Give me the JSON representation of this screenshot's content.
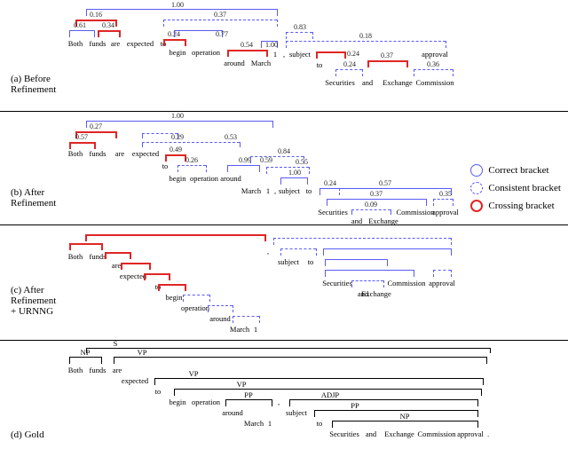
{
  "chart_data": {
    "type": "table",
    "sentence": [
      "Both",
      "funds",
      "are",
      "expected",
      "to",
      "begin",
      "operation",
      "around",
      "March",
      "1",
      ",",
      "subject",
      "to",
      "Securities",
      "and",
      "Exchange",
      "Commission",
      "approval",
      "."
    ],
    "legend": [
      "Correct bracket",
      "Consistent bracket",
      "Crossing bracket"
    ],
    "panels": {
      "before_refinement": {
        "label": "(a) Before Refinement",
        "brackets": [
          {
            "span": [
              1,
              2
            ],
            "type": "correct",
            "score": 0.61
          },
          {
            "span": [
              2,
              3
            ],
            "type": "crossing",
            "score": 0.34
          },
          {
            "span": [
              1,
              3
            ],
            "type": "crossing",
            "score": 0.16
          },
          {
            "span": [
              1,
              4
            ],
            "type": "correct",
            "score": 1.0
          },
          {
            "span": [
              5,
              6
            ],
            "type": "crossing",
            "score": 0.24
          },
          {
            "span": [
              5,
              7
            ],
            "type": "correct",
            "score": 0.77
          },
          {
            "span": [
              8,
              9
            ],
            "type": "crossing",
            "score": 0.54
          },
          {
            "span": [
              5,
              9
            ],
            "type": "consistent",
            "score": 0.37
          },
          {
            "span": [
              9,
              10
            ],
            "type": "correct",
            "score": 1.0
          },
          {
            "span": [
              11,
              12
            ],
            "type": "consistent",
            "score": 0.83
          },
          {
            "span": [
              11,
              13
            ],
            "type": "consistent",
            "score": 0.18
          },
          {
            "span": [
              13,
              14
            ],
            "type": "crossing",
            "score": 0.24
          },
          {
            "span": [
              14,
              15
            ],
            "type": "consistent",
            "score": 0.24
          },
          {
            "span": [
              15,
              16
            ],
            "type": "crossing",
            "score": 0.37
          },
          {
            "span": [
              16,
              17
            ],
            "type": "consistent",
            "score": 0.36
          },
          {
            "span": [
              14,
              17
            ],
            "type": "consistent",
            "score": 0.24
          }
        ]
      },
      "after_refinement": {
        "label": "(b) After Refinement",
        "brackets": [
          {
            "span": [
              1,
              2
            ],
            "type": "crossing",
            "score": 0.57
          },
          {
            "span": [
              1,
              3
            ],
            "type": "crossing",
            "score": 0.27
          },
          {
            "span": [
              1,
              4
            ],
            "type": "correct",
            "score": 1.0
          },
          {
            "span": [
              4,
              5
            ],
            "type": "consistent",
            "score": 0.29
          },
          {
            "span": [
              5,
              6
            ],
            "type": "crossing",
            "score": 0.49
          },
          {
            "span": [
              6,
              7
            ],
            "type": "consistent",
            "score": 0.26
          },
          {
            "span": [
              4,
              7
            ],
            "type": "consistent",
            "score": 0.53
          },
          {
            "span": [
              7,
              8
            ],
            "type": "consistent",
            "score": 0.59
          },
          {
            "span": [
              4,
              9
            ],
            "type": "correct",
            "score": 0.99
          },
          {
            "span": [
              9,
              10
            ],
            "type": "consistent",
            "score": 0.84
          },
          {
            "span": [
              10,
              11
            ],
            "type": "consistent",
            "score": 0.55
          },
          {
            "span": [
              11,
              12
            ],
            "type": "correct",
            "score": 1.0
          },
          {
            "span": [
              12,
              13
            ],
            "type": "consistent",
            "score": 0.24
          },
          {
            "span": [
              13,
              14
            ],
            "type": "correct",
            "score": 0.57
          },
          {
            "span": [
              14,
              15
            ],
            "type": "consistent",
            "score": 0.09
          },
          {
            "span": [
              13,
              16
            ],
            "type": "correct",
            "score": 0.37
          },
          {
            "span": [
              16,
              17
            ],
            "type": "consistent",
            "score": 0.35
          }
        ]
      },
      "after_refinement_urnng": {
        "label": "(c) After Refinement + URNNG",
        "brackets": [
          {
            "span": [
              1,
              2
            ],
            "type": "crossing"
          },
          {
            "span": [
              1,
              3
            ],
            "type": "crossing"
          },
          {
            "span": [
              1,
              4
            ],
            "type": "crossing"
          },
          {
            "span": [
              1,
              5
            ],
            "type": "crossing"
          },
          {
            "span": [
              1,
              6
            ],
            "type": "crossing"
          },
          {
            "span": [
              6,
              7
            ],
            "type": "consistent"
          },
          {
            "span": [
              7,
              8
            ],
            "type": "consistent"
          },
          {
            "span": [
              8,
              9
            ],
            "type": "consistent"
          },
          {
            "span": [
              9,
              10
            ],
            "type": "consistent"
          },
          {
            "span": [
              11,
              12
            ],
            "type": "consistent"
          },
          {
            "span": [
              11,
              13
            ],
            "type": "consistent"
          },
          {
            "span": [
              14,
              15
            ],
            "type": "consistent"
          },
          {
            "span": [
              13,
              15
            ],
            "type": "correct"
          },
          {
            "span": [
              13,
              16
            ],
            "type": "correct"
          },
          {
            "span": [
              16,
              17
            ],
            "type": "consistent"
          },
          {
            "span": [
              13,
              18
            ],
            "type": "correct"
          }
        ]
      },
      "gold": {
        "label": "(d) Gold",
        "nodes": [
          "S",
          "NP",
          "VP",
          "VP",
          "VP",
          "PP",
          "ADJP",
          "PP",
          "NP"
        ],
        "brackets": [
          {
            "span": [
              1,
              2
            ],
            "tag": "NP"
          },
          {
            "span": [
              1,
              19
            ],
            "tag": "S"
          },
          {
            "span": [
              3,
              18
            ],
            "tag": "VP"
          },
          {
            "span": [
              5,
              18
            ],
            "tag": "VP"
          },
          {
            "span": [
              8,
              10
            ],
            "tag": "PP"
          },
          {
            "span": [
              6,
              18
            ],
            "tag": "VP"
          },
          {
            "span": [
              12,
              18
            ],
            "tag": "ADJP"
          },
          {
            "span": [
              13,
              18
            ],
            "tag": "PP"
          },
          {
            "span": [
              14,
              18
            ],
            "tag": "NP"
          }
        ]
      }
    }
  },
  "labels": {
    "panel_a": "(a) Before",
    "panel_a2": "Refinement",
    "panel_b": "(b) After",
    "panel_b2": "Refinement",
    "panel_c": "(c) After",
    "panel_c2": "Refinement",
    "panel_c3": "+ URNNG",
    "panel_d": "(d) Gold"
  },
  "legend": {
    "correct": "Correct bracket",
    "consistent": "Consistent bracket",
    "crossing": "Crossing bracket"
  },
  "sentence": {
    "w1": "Both",
    "w2": "funds",
    "w3": "are",
    "w4": "expected",
    "w5": "to",
    "w6": "begin",
    "w7": "operation",
    "w8": "around",
    "w9": "March",
    "w10": "1",
    "w11": ",",
    "w12": "subject",
    "w13": "to",
    "w14": "Securities",
    "w15": "and",
    "w16": "Exchange",
    "w17": "Commission",
    "w18": "approval",
    "w19": "."
  },
  "gold_tags": {
    "t1": "S",
    "t2": "NP",
    "t3": "VP",
    "t4": "VP",
    "t5": "VP",
    "t6": "PP",
    "t7": "ADJP",
    "t8": "PP",
    "t9": "NP"
  },
  "vals": {
    "a_100": "1.00",
    "a_016": "0.16",
    "a_037": "0.37",
    "a_061": "0.61",
    "a_034": "0.34",
    "a_024": "0.24",
    "a_077": "0.77",
    "a_054": "0.54",
    "a_100b": "1.00",
    "a_083": "0.83",
    "a_018": "0.18",
    "a_024b": "0.24",
    "a_037b": "0.37",
    "a_024c": "0.24",
    "a_036": "0.36",
    "b_100": "1.00",
    "b_027": "0.27",
    "b_029": "0.29",
    "b_057": "0.57",
    "b_053": "0.53",
    "b_049": "0.49",
    "b_026": "0.26",
    "b_099": "0.99",
    "b_059": "0.59",
    "b_084": "0.84",
    "b_055": "0.55",
    "b_100b": "1.00",
    "b_024": "0.24",
    "b_057b": "0.57",
    "b_037": "0.37",
    "b_009": "0.09",
    "b_035": "0.35"
  }
}
